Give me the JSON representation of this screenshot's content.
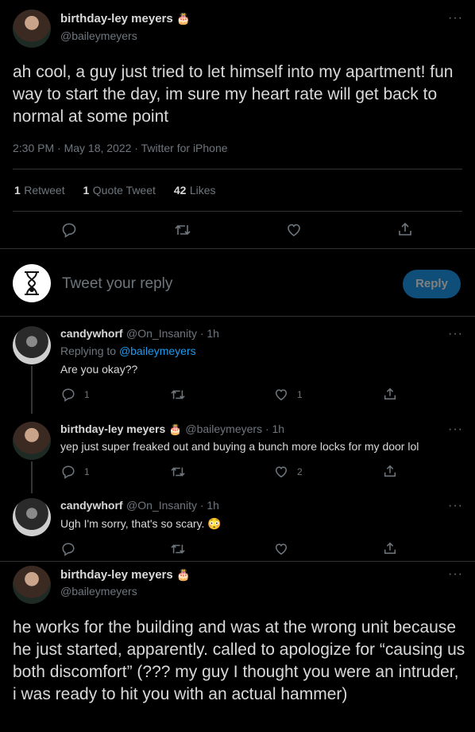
{
  "main_tweet": {
    "display_name": "birthday-ley meyers",
    "handle": "@baileymeyers",
    "name_emoji": "🎂",
    "text": "ah cool, a guy just tried to let himself into my apartment! fun way to start the day, im sure my heart rate will get back to normal at some point",
    "meta": "2:30 PM · May 18, 2022 · Twitter for iPhone",
    "more": "···",
    "stats": {
      "retweets": "1",
      "retweets_label": "Retweet",
      "quotes": "1",
      "quotes_label": "Quote Tweet",
      "likes": "42",
      "likes_label": "Likes"
    }
  },
  "composer": {
    "placeholder": "Tweet your reply",
    "button_label": "Reply"
  },
  "replies": [
    {
      "display_name": "candywhorf",
      "handle_time": "@On_Insanity · 1h",
      "replying_prefix": "Replying to",
      "replying_to": "@baileymeyers",
      "text": "Are you okay??",
      "reply_count": "1",
      "like_count": "1"
    },
    {
      "display_name": "birthday-ley meyers",
      "name_emoji": "🎂",
      "handle_time": "@baileymeyers · 1h",
      "text": "yep just super freaked out and buying a bunch more locks for my door lol",
      "reply_count": "1",
      "like_count": "2"
    },
    {
      "display_name": "candywhorf",
      "handle_time": "@On_Insanity · 1h",
      "text": "Ugh I'm sorry, that's so scary.",
      "text_emoji": "😳"
    }
  ],
  "last_tweet": {
    "display_name": "birthday-ley meyers",
    "name_emoji": "🎂",
    "handle": "@baileymeyers",
    "text": "he works for the building and was at the wrong unit because he just started, apparently. called to apologize for “causing us both discomfort” (??? my guy I thought you were an intruder, i was ready to hit you with an actual hammer)"
  },
  "icons": {
    "reply": "reply-icon",
    "retweet": "retweet-icon",
    "like": "heart-icon",
    "share": "share-icon",
    "more": "more-icon"
  },
  "colors": {
    "background": "#000000",
    "text": "#d9d9d9",
    "muted": "#6e767d",
    "link": "#1d9bf0",
    "reply_button": "#0f4e78"
  }
}
